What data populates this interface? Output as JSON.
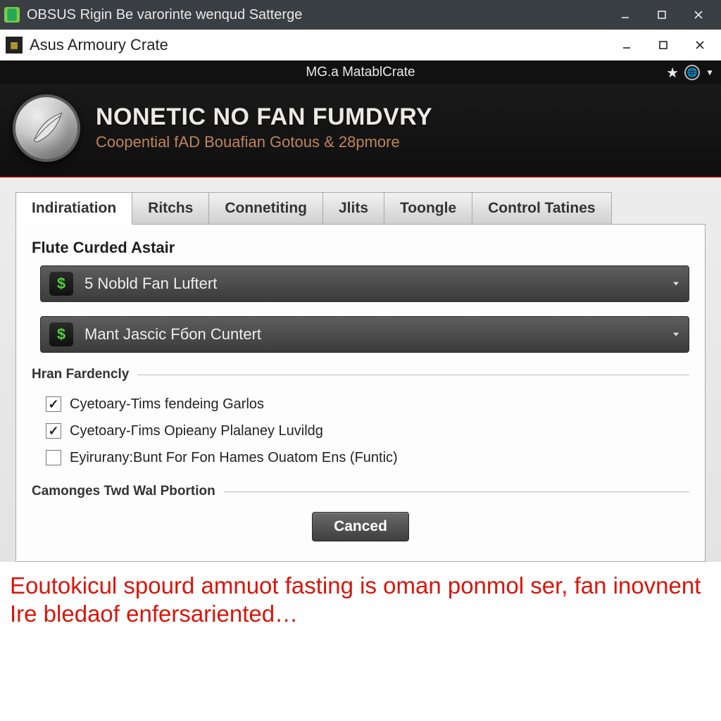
{
  "outer_titlebar": {
    "title": "OBSUS Rigin Be varorinte wenqud Satterge"
  },
  "inner_titlebar": {
    "title": "Asus Armoury Crate"
  },
  "header_strip": {
    "title": "MG.a MatablCrate"
  },
  "banner": {
    "title": "Nonetic No Fan Fumdvry",
    "subtitle": "Coopential fAD Bouafian Gotous & 28pmore"
  },
  "tabs": [
    {
      "label": "Indiratiation",
      "active": true
    },
    {
      "label": "Ritchs"
    },
    {
      "label": "Connetiting"
    },
    {
      "label": "Jlits"
    },
    {
      "label": "Toongle"
    },
    {
      "label": "Control Tatines"
    }
  ],
  "section1": {
    "heading": "Flute Curded Astair",
    "selectors": [
      {
        "badge": "$",
        "label": "5 Nobld Fan Luftert"
      },
      {
        "badge": "$",
        "label": "Mant Jascic Fбon Cuntert"
      }
    ]
  },
  "section2": {
    "legend": "Hran Fardencly",
    "items": [
      {
        "checked": true,
        "label": "Cyetoary-Tims fendeing Garlos"
      },
      {
        "checked": true,
        "label": "Cyetoary-Гims Opieany Plalaney Luvildg"
      },
      {
        "checked": false,
        "label": "Eyirurany:Bunt For Fon Hames Ouatom Ens (Funtic)"
      }
    ]
  },
  "section3": {
    "legend": "Camonges Twd Wal Pbortion"
  },
  "buttons": {
    "cancel": "Canced"
  },
  "footer_text": "Eoutokicul spourd amnuot fasting is oman ponmol ser, fan inovnent Ire bledaof enfersariented…",
  "icons": {
    "minimize": "minimize-icon",
    "maximize": "maximize-icon",
    "close": "close-icon",
    "star": "star-icon",
    "globe": "globe-icon",
    "chevron_down": "chevron-down-icon",
    "leaf": "leaf-icon",
    "dollar": "dollar-icon"
  }
}
